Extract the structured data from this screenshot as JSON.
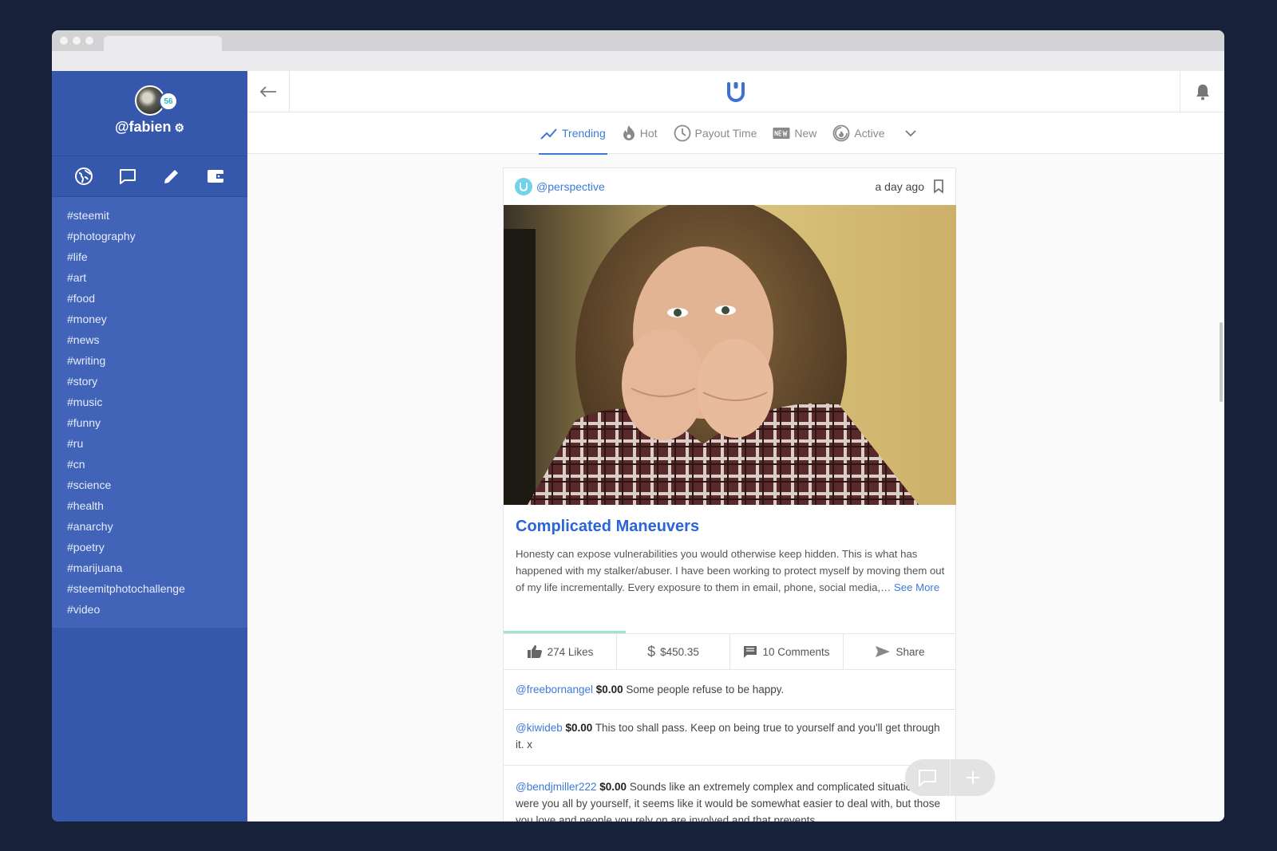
{
  "colors": {
    "sidebar": "#3558ac",
    "tag_panel": "#4264b8",
    "accent": "#3e7ad8",
    "title": "#2a64d6",
    "progress": "#9ee3d3"
  },
  "profile": {
    "username": "@fabien",
    "badge": "56"
  },
  "sidebar": {
    "icons": [
      "globe-icon",
      "chat-icon",
      "pencil-icon",
      "wallet-icon"
    ],
    "tags": [
      "#steemit",
      "#photography",
      "#life",
      "#art",
      "#food",
      "#money",
      "#news",
      "#writing",
      "#story",
      "#music",
      "#funny",
      "#ru",
      "#cn",
      "#science",
      "#health",
      "#anarchy",
      "#poetry",
      "#marijuana",
      "#steemitphotochallenge",
      "#video"
    ]
  },
  "sort": {
    "tabs": [
      {
        "label": "Trending",
        "icon": "trending-icon",
        "active": true
      },
      {
        "label": "Hot",
        "icon": "flame-icon",
        "active": false
      },
      {
        "label": "Payout Time",
        "icon": "clock-icon",
        "active": false
      },
      {
        "label": "New",
        "icon": "new-badge-icon",
        "active": false
      },
      {
        "label": "Active",
        "icon": "active-icon",
        "active": false
      }
    ]
  },
  "post": {
    "author": "@perspective",
    "time": "a day ago",
    "title": "Complicated Maneuvers",
    "body": "Honesty can expose vulnerabilities you would otherwise keep hidden. This is what has happened with my stalker/abuser. I have been working to protect myself by moving them out of my life incrementally. Every exposure to them in email, phone, social media,…",
    "see_more": "See More",
    "progress": 0.27,
    "likes": "274 Likes",
    "payout": "$450.35",
    "comments": "10 Comments",
    "share": "Share"
  },
  "comments": [
    {
      "user": "@freebornangel",
      "amount": "$0.00",
      "text": "Some people refuse to be happy."
    },
    {
      "user": "@kiwideb",
      "amount": "$0.00",
      "text": "This too shall pass. Keep on being true to yourself and you'll get through it. x"
    },
    {
      "user": "@bendjmiller222",
      "amount": "$0.00",
      "text": "Sounds like an extremely complex and complicated situation. If it were you all by yourself, it seems like it would be somewhat easier to deal with, but those you love and people you rely on are involved and that prevents"
    }
  ]
}
